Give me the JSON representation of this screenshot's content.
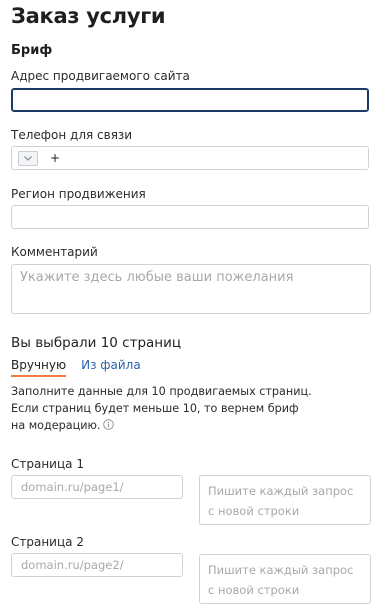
{
  "page_title": "Заказ услуги",
  "section_title": "Бриф",
  "site_address": {
    "label": "Адрес продвигаемого сайта",
    "value": ""
  },
  "phone": {
    "label": "Телефон для связи",
    "prefix": "+"
  },
  "region": {
    "label": "Регион продвижения",
    "value": ""
  },
  "comment": {
    "label": "Комментарий",
    "placeholder": "Укажите здесь любые ваши пожелания"
  },
  "selection": {
    "title": "Вы выбрали 10 страниц",
    "tabs": [
      {
        "label": "Вручную",
        "active": true
      },
      {
        "label": "Из файла",
        "active": false
      }
    ],
    "info_lines": [
      "Заполните данные для 10 продвигаемых страниц.",
      "Если страниц будет меньше 10, то вернем бриф",
      "на модерацию."
    ],
    "info_icon": "info-circle-icon"
  },
  "pages": [
    {
      "label": "Страница 1",
      "url_placeholder": "domain.ru/page1/",
      "queries_placeholder": "Пишите каждый запрос с новой строки"
    },
    {
      "label": "Страница 2",
      "url_placeholder": "domain.ru/page2/",
      "queries_placeholder": "Пишите каждый запрос с новой строки"
    }
  ],
  "colors": {
    "accent_underline": "#f27a3a",
    "link": "#2b63a8",
    "focus_border": "#1b3a66"
  }
}
